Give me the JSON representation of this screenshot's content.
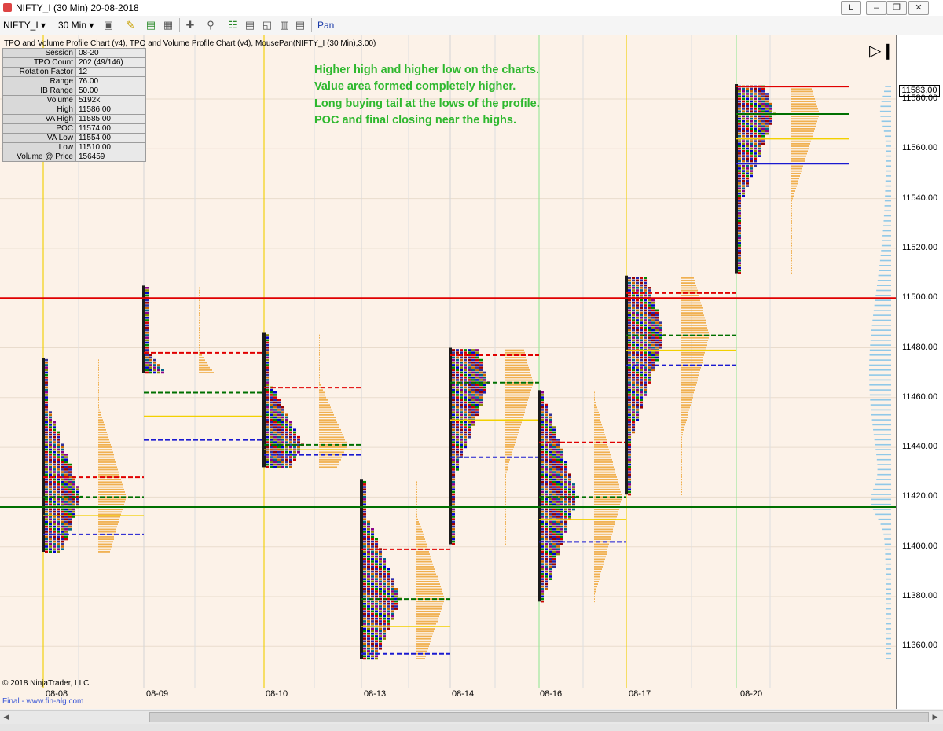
{
  "window": {
    "title": "NIFTY_I (30 Min)  20-08-2018",
    "btn_l": "L"
  },
  "toolbar": {
    "instrument": "NIFTY_I",
    "interval": "30 Min",
    "pan_label": "Pan"
  },
  "chart_header": "TPO and Volume Profile Chart (v4),  TPO and Volume Profile Chart (v4), MousePan(NIFTY_I (30 Min),3.00)",
  "info_table": [
    {
      "k": "Session",
      "v": "08-20"
    },
    {
      "k": "TPO Count",
      "v": "202 (49/146)"
    },
    {
      "k": "Rotation Factor",
      "v": "12"
    },
    {
      "k": "Range",
      "v": "76.00"
    },
    {
      "k": "IB Range",
      "v": "50.00"
    },
    {
      "k": "Volume",
      "v": "5192k"
    },
    {
      "k": "High",
      "v": "11586.00"
    },
    {
      "k": "VA High",
      "v": "11585.00"
    },
    {
      "k": "POC",
      "v": "11574.00"
    },
    {
      "k": "VA Low",
      "v": "11554.00"
    },
    {
      "k": "Low",
      "v": "11510.00"
    },
    {
      "k": "Volume @ Price",
      "v": "156459"
    }
  ],
  "annotation": [
    "Higher high and higher low on the charts.",
    "Value area formed completely higher.",
    "Long buying tail at the lows of the profile.",
    "POC and final closing near the highs."
  ],
  "last_price": "11583.00",
  "copyright": "© 2018 NinjaTrader, LLC",
  "footer": "Final - www.fin-alg.com",
  "chart_data": {
    "type": "market-profile",
    "y_ticks": [
      "11580.00",
      "11560.00",
      "11540.00",
      "11520.00",
      "11500.00",
      "11480.00",
      "11460.00",
      "11440.00",
      "11420.00",
      "11400.00",
      "11380.00",
      "11360.00"
    ],
    "x_ticks": [
      "08-08",
      "08-09",
      "08-10",
      "08-13",
      "08-14",
      "08-16",
      "08-17",
      "08-20"
    ],
    "ylim": [
      11353,
      11590
    ],
    "sessions": [
      {
        "date": "08-08",
        "high": 11476,
        "low": 11398,
        "vah": 11428,
        "poc": 11420,
        "val": 11405
      },
      {
        "date": "08-09",
        "high": 11505,
        "low": 11470,
        "vah": 11478,
        "poc": 11462,
        "val": 11443
      },
      {
        "date": "08-10",
        "high": 11486,
        "low": 11432,
        "vah": 11464,
        "poc": 11441,
        "val": 11437
      },
      {
        "date": "08-13",
        "high": 11427,
        "low": 11355,
        "vah": 11399,
        "poc": 11379,
        "val": 11357
      },
      {
        "date": "08-14",
        "high": 11480,
        "low": 11401,
        "vah": 11477,
        "poc": 11466,
        "val": 11436
      },
      {
        "date": "08-16",
        "high": 11463,
        "low": 11378,
        "vah": 11442,
        "poc": 11420,
        "val": 11402
      },
      {
        "date": "08-17",
        "high": 11509,
        "low": 11421,
        "vah": 11502,
        "poc": 11485,
        "val": 11473
      },
      {
        "date": "08-20",
        "high": 11586,
        "low": 11510,
        "vah": 11585,
        "poc": 11574,
        "val": 11554
      }
    ],
    "level_lines": [
      11500,
      11416
    ]
  },
  "colors": {
    "chart_bg": "#fcf2e8",
    "annotation": "#2eb82e",
    "vah": "#e00000",
    "poc": "#007000",
    "val": "#1a1ad0",
    "vwap": "#f2d000",
    "volume": "#f0b050",
    "composite": "#8fc8e8"
  }
}
